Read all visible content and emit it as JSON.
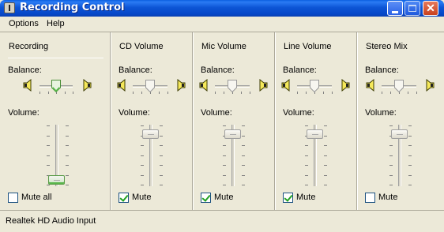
{
  "window": {
    "title": "Recording Control"
  },
  "menu": {
    "options": "Options",
    "help": "Help"
  },
  "channels": [
    {
      "title": "Recording",
      "balance_label": "Balance:",
      "volume_label": "Volume:",
      "volume_level": 0.1,
      "balance": 0.0,
      "active": true,
      "mute_label": "Mute all",
      "mute_checked": false
    },
    {
      "title": "CD Volume",
      "balance_label": "Balance:",
      "volume_label": "Volume:",
      "volume_level": 0.85,
      "balance": 0.0,
      "active": false,
      "mute_label": "Mute",
      "mute_checked": true
    },
    {
      "title": "Mic Volume",
      "balance_label": "Balance:",
      "volume_label": "Volume:",
      "volume_level": 0.85,
      "balance": 0.0,
      "active": false,
      "mute_label": "Mute",
      "mute_checked": true
    },
    {
      "title": "Line Volume",
      "balance_label": "Balance:",
      "volume_label": "Volume:",
      "volume_level": 0.85,
      "balance": 0.0,
      "active": false,
      "mute_label": "Mute",
      "mute_checked": true
    },
    {
      "title": "Stereo Mix",
      "balance_label": "Balance:",
      "volume_label": "Volume:",
      "volume_level": 0.85,
      "balance": 0.0,
      "active": false,
      "mute_label": "Mute",
      "mute_checked": false
    }
  ],
  "status": {
    "text": "Realtek HD Audio Input"
  },
  "colors": {
    "titlebar": "#0a5fe0",
    "face": "#ece9d8",
    "check": "#21a121"
  }
}
